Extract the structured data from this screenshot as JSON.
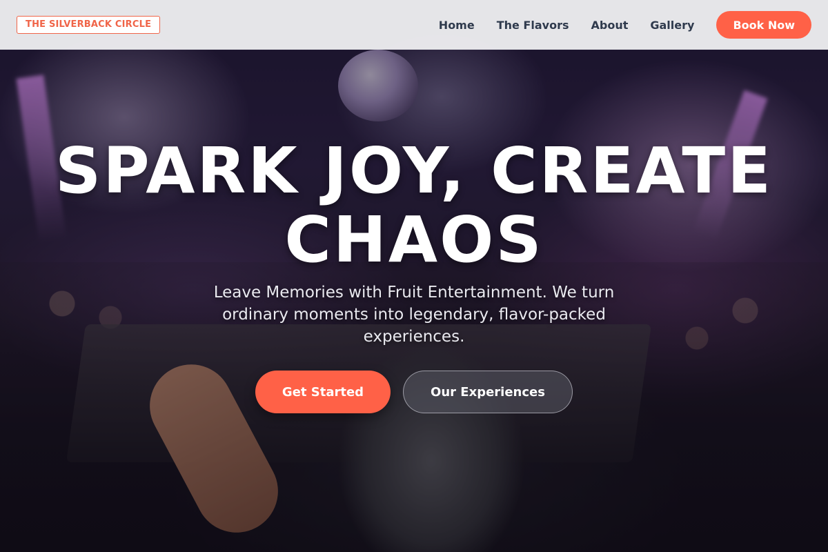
{
  "nav": {
    "brand": "THE SILVERBACK CIRCLE",
    "links": [
      "Home",
      "The Flavors",
      "About",
      "Gallery"
    ],
    "cta": "Book Now"
  },
  "hero": {
    "title_line1": "SPARK JOY, CREATE",
    "title_line2": "CHAOS",
    "subtitle": "Leave Memories with Fruit Entertainment. We turn ordinary moments into legendary, flavor-packed experiences.",
    "primary_cta": "Get Started",
    "secondary_cta": "Our Experiences"
  },
  "colors": {
    "accent": "#ff6147",
    "nav_text": "#2f3a4d",
    "nav_bg": "#f0f0f2"
  }
}
